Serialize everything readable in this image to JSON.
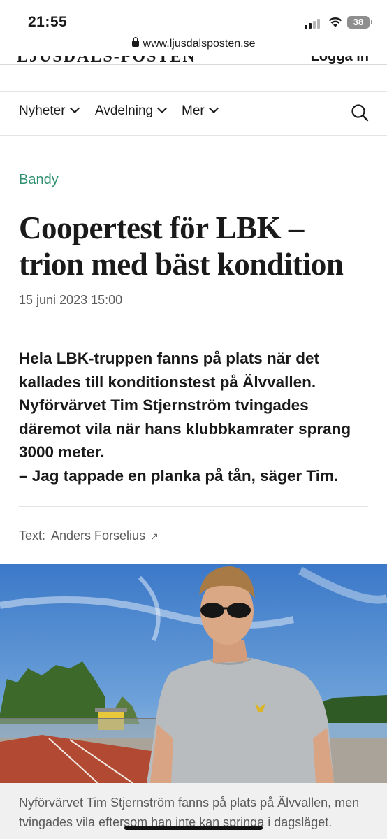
{
  "status_bar": {
    "time": "21:55",
    "battery": "38"
  },
  "browser": {
    "url": "www.ljusdalsposten.se"
  },
  "masthead": {
    "logo": "LJUSDALS-POSTEN",
    "login": "Logga in"
  },
  "nav": {
    "items": [
      {
        "label": "Nyheter"
      },
      {
        "label": "Avdelning"
      },
      {
        "label": "Mer"
      }
    ],
    "search_icon": "search-icon"
  },
  "article": {
    "category": "Bandy",
    "headline": "Coopertest för LBK – trion med bäst kondition",
    "date": "15 juni 2023 15:00",
    "ingress": [
      "Hela LBK-truppen fanns på plats när det kallades till konditionstest på Älvvallen. Nyförvärvet Tim Stjernström tvingades däremot vila när hans klubbkamrater sprang 3000 meter.",
      "– Jag tappade en planka på tån, säger Tim."
    ],
    "byline_label": "Text:",
    "author": "Anders Forselius",
    "author_link_icon": "↗",
    "image_caption": "Nyförvärvet Tim Stjernström fanns på plats på Älvvallen, men tvingades vila eftersom han inte kan springa i dagsläget."
  },
  "colors": {
    "accent": "#2f8f6f",
    "text": "#1a1a1a",
    "muted": "#5a5a5a"
  }
}
